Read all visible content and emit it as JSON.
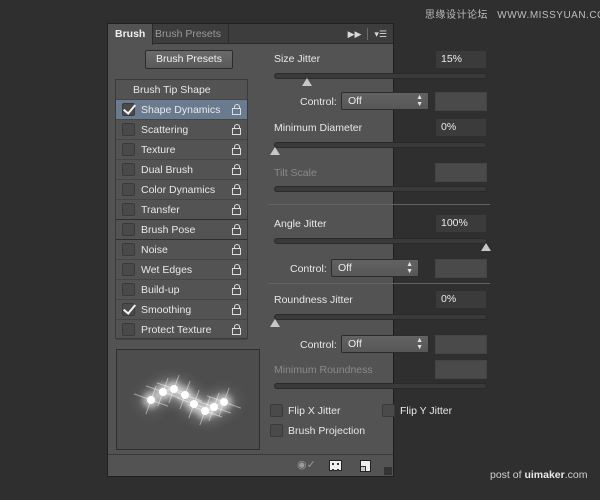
{
  "watermarks": {
    "top_cn": "思缘设计论坛",
    "top_url": "WWW.MISSYUAN.COM",
    "bottom_prefix": "post of ",
    "bottom_brand": "uimaker",
    "bottom_suffix": ".com"
  },
  "tabs": [
    {
      "label": "Brush",
      "active": true
    },
    {
      "label": "Brush Presets",
      "active": false
    }
  ],
  "tabbar_icons": [
    "collapse-icon",
    "panel-menu-icon"
  ],
  "brush_presets_button": "Brush Presets",
  "options": {
    "header": "Brush Tip Shape",
    "items": [
      {
        "label": "Shape Dynamics",
        "checked": true,
        "selected": true,
        "locked": false
      },
      {
        "label": "Scattering",
        "checked": false,
        "selected": false,
        "locked": false
      },
      {
        "label": "Texture",
        "checked": false,
        "selected": false,
        "locked": false
      },
      {
        "label": "Dual Brush",
        "checked": false,
        "selected": false,
        "locked": false
      },
      {
        "label": "Color Dynamics",
        "checked": false,
        "selected": false,
        "locked": false
      },
      {
        "label": "Transfer",
        "checked": false,
        "selected": false,
        "locked": false
      },
      {
        "label": "Brush Pose",
        "checked": false,
        "selected": false,
        "locked": false
      },
      {
        "label": "Noise",
        "checked": false,
        "selected": false,
        "locked": false
      },
      {
        "label": "Wet Edges",
        "checked": false,
        "selected": false,
        "locked": false
      },
      {
        "label": "Build-up",
        "checked": false,
        "selected": false,
        "locked": false
      },
      {
        "label": "Smoothing",
        "checked": true,
        "selected": false,
        "locked": false
      },
      {
        "label": "Protect Texture",
        "checked": false,
        "selected": false,
        "locked": false
      }
    ]
  },
  "settings": {
    "size_jitter": {
      "label": "Size Jitter",
      "value": "15%",
      "percent": 15
    },
    "size_control": {
      "label": "Control:",
      "value": "Off"
    },
    "minimum_diameter": {
      "label": "Minimum Diameter",
      "value": "0%",
      "percent": 0
    },
    "tilt_scale": {
      "label": "Tilt Scale",
      "value": "",
      "disabled": true
    },
    "angle_jitter": {
      "label": "Angle Jitter",
      "value": "100%",
      "percent": 100
    },
    "angle_control": {
      "label": "Control:",
      "value": "Off"
    },
    "roundness_jitter": {
      "label": "Roundness Jitter",
      "value": "0%",
      "percent": 0
    },
    "roundness_control": {
      "label": "Control:",
      "value": "Off"
    },
    "minimum_roundness": {
      "label": "Minimum Roundness",
      "value": "",
      "disabled": true
    },
    "flip_x": {
      "label": "Flip X Jitter",
      "checked": false
    },
    "flip_y": {
      "label": "Flip Y Jitter",
      "checked": false
    },
    "brush_projection": {
      "label": "Brush Projection",
      "checked": false
    }
  },
  "footer_icons": [
    "toggle-live-tip-preview-icon",
    "show-brush-grid-icon",
    "create-new-brush-icon"
  ]
}
